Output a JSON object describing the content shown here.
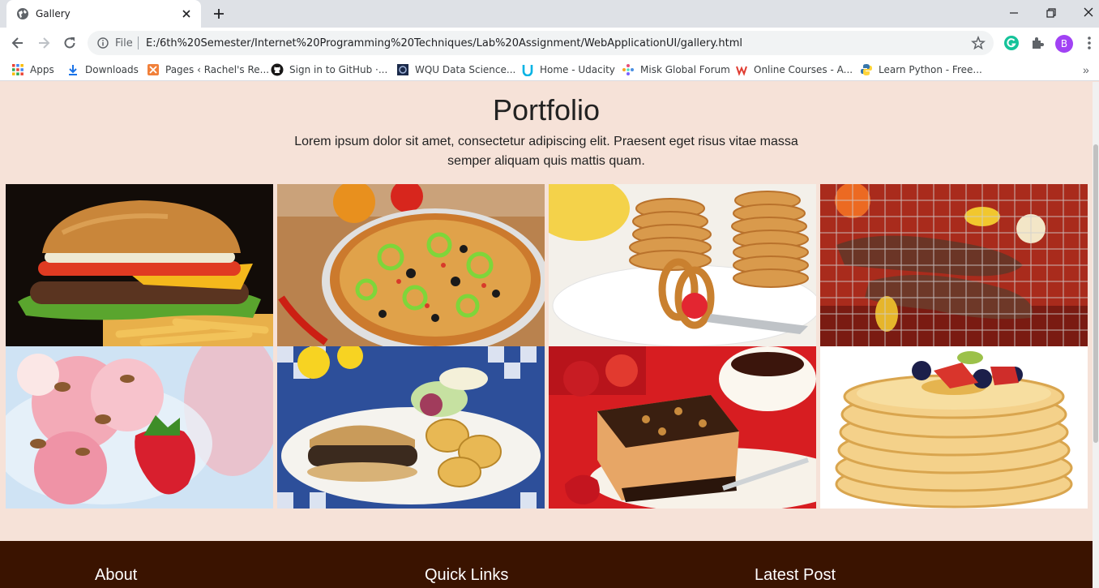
{
  "browser": {
    "tab_title": "Gallery",
    "omnibox": {
      "scheme_label": "File",
      "url": "E:/6th%20Semester/Internet%20Programming%20Techniques/Lab%20Assignment/WebApplicationUI/gallery.html"
    },
    "profile_initial": "B",
    "bookmarks": [
      {
        "label": "Apps",
        "icon": "apps-grid-icon"
      },
      {
        "label": "Downloads",
        "icon": "download-icon"
      },
      {
        "label": "Pages ‹ Rachel's Re...",
        "icon": "pages-icon"
      },
      {
        "label": "Sign in to GitHub ·...",
        "icon": "github-icon"
      },
      {
        "label": "WQU Data Science...",
        "icon": "wqu-icon"
      },
      {
        "label": "Home - Udacity",
        "icon": "udacity-icon"
      },
      {
        "label": "Misk Global Forum",
        "icon": "misk-icon"
      },
      {
        "label": "Online Courses - A...",
        "icon": "courses-icon"
      },
      {
        "label": "Learn Python - Free...",
        "icon": "python-icon"
      }
    ]
  },
  "page": {
    "title": "Portfolio",
    "description": "Lorem ipsum dolor sit amet, consectetur adipiscing elit. Praesent eget risus vitae massa semper aliquam quis mattis quam.",
    "gallery": [
      {
        "subject": "burger-and-fries"
      },
      {
        "subject": "pizza"
      },
      {
        "subject": "mini-pancakes"
      },
      {
        "subject": "grilled-meat"
      },
      {
        "subject": "strawberry-ice-cream"
      },
      {
        "subject": "burger-plate-with-chips"
      },
      {
        "subject": "cheesecake-slice"
      },
      {
        "subject": "pancake-stack-with-berries"
      }
    ],
    "footer": {
      "about_heading": "About",
      "links_heading": "Quick Links",
      "post_heading": "Latest Post"
    }
  },
  "colors": {
    "page_background": "#f6e2d8",
    "footer_background": "#3a1300"
  }
}
